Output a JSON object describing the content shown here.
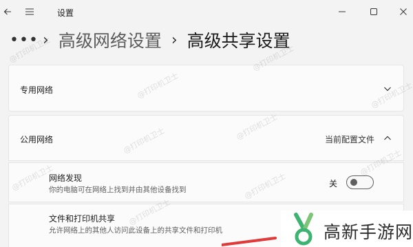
{
  "window": {
    "title": "设置",
    "controls": {
      "minimize": "minimize",
      "maximize": "maximize",
      "close": "close"
    }
  },
  "breadcrumb": {
    "more": "•••",
    "separator": "›",
    "parent": "高级网络设置",
    "current": "高级共享设置"
  },
  "sections": {
    "private": {
      "label": "专用网络",
      "expanded": false
    },
    "public": {
      "label": "公用网络",
      "status": "当前配置文件",
      "expanded": true,
      "items": [
        {
          "title": "网络发现",
          "description": "你的电脑可在网络上找到并由其他设备找到",
          "toggle_label": "关",
          "toggle_on": false
        },
        {
          "title": "文件和打印机共享",
          "description": "允许网络上的其他人访问此设备上的共享文件和打印机"
        }
      ]
    }
  },
  "watermark": "@打印机卫士",
  "logo": {
    "text": "高新手游网"
  },
  "colors": {
    "background": "#f3f3f3",
    "card": "#fbfbfb",
    "border": "#e5e5e5",
    "logo_green": "#3cb371",
    "accent_red": "#e03a3a"
  }
}
